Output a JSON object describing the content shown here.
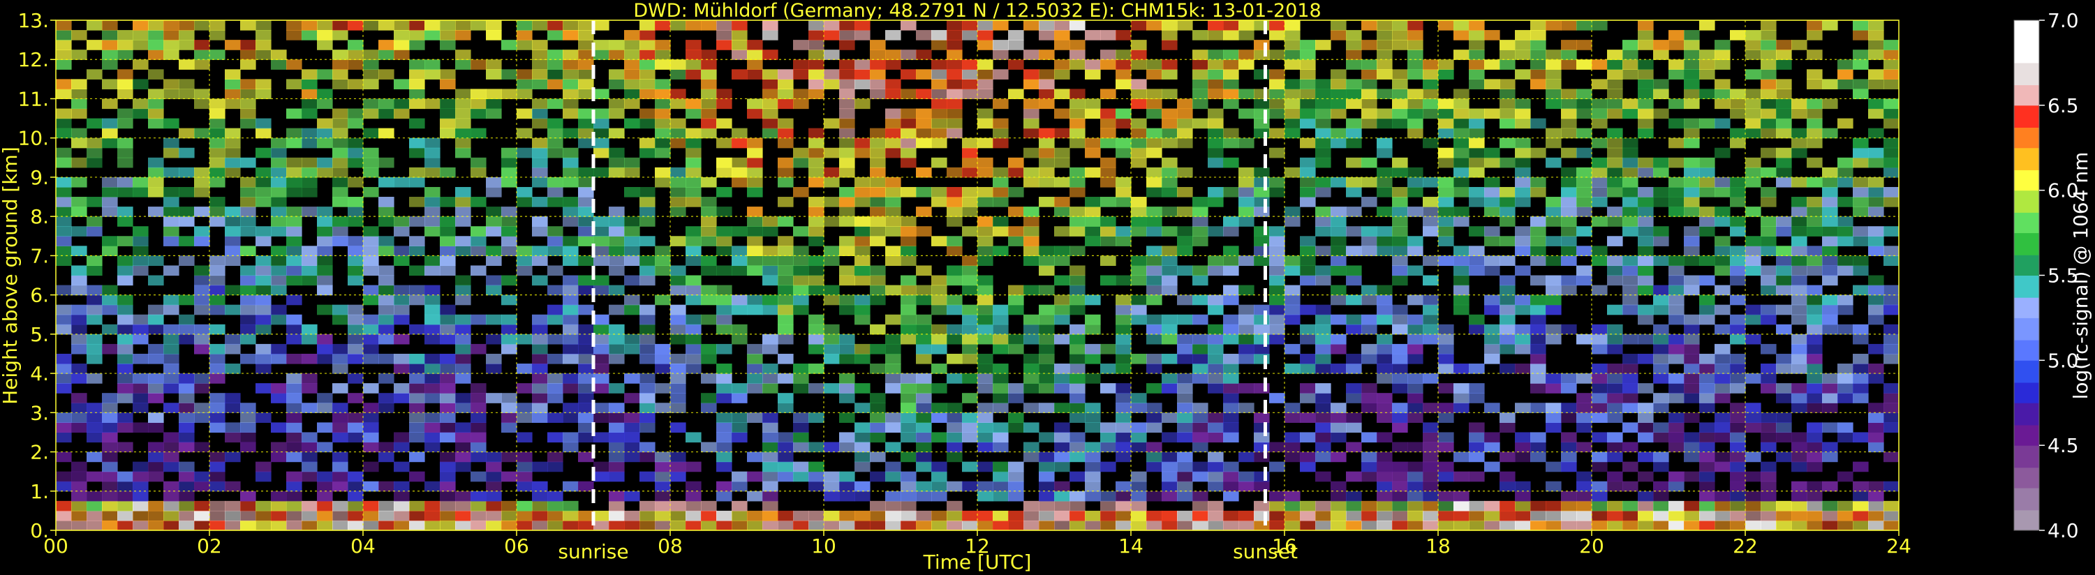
{
  "chart_data": {
    "type": "heatmap",
    "title": "DWD: Mühldorf (Germany; 48.2791 N / 12.5032 E):    CHM15k: 13-01-2018",
    "xlabel": "Time [UTC]",
    "ylabel": "Height above ground [km]",
    "xlim": [
      0,
      24
    ],
    "ylim": [
      0,
      13
    ],
    "x_ticks": [
      "00",
      "02",
      "04",
      "06",
      "08",
      "10",
      "12",
      "14",
      "16",
      "18",
      "20",
      "22",
      "24"
    ],
    "y_ticks": [
      "0.",
      "1.",
      "2.",
      "3.",
      "4.",
      "5.",
      "6.",
      "7.",
      "8.",
      "9.",
      "10.",
      "11.",
      "12.",
      "13."
    ],
    "grid": true,
    "grid_color": "#ffff00",
    "markers": [
      {
        "label": "sunrise",
        "x": 7.0
      },
      {
        "label": "sunset",
        "x": 15.75
      }
    ],
    "colorbar": {
      "label": "log(rc-signal) @ 1064 nm",
      "range": [
        4.0,
        7.0
      ],
      "ticks": [
        "4.0",
        "4.5",
        "5.0",
        "5.5",
        "6.0",
        "6.5",
        "7.0"
      ]
    }
  }
}
